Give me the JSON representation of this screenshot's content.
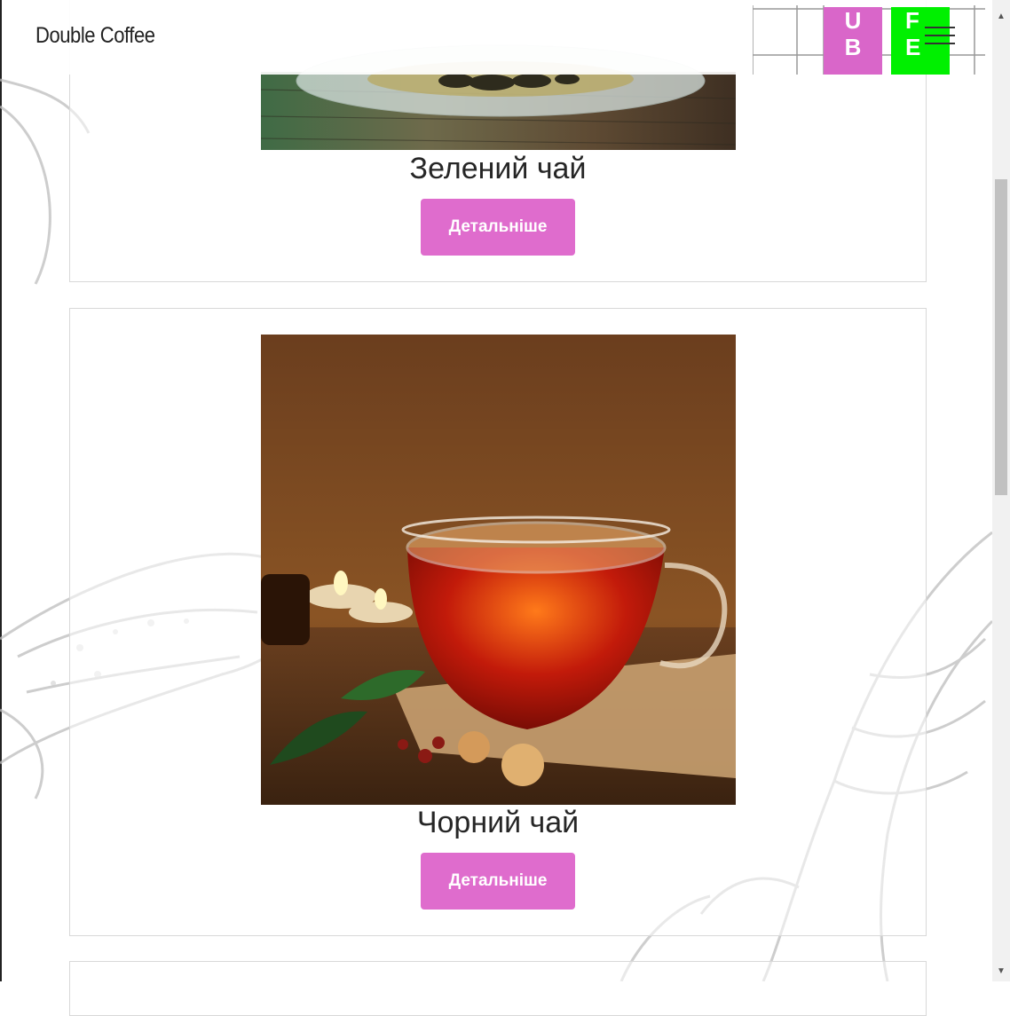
{
  "header": {
    "brand": "Double Coffee",
    "logo_ub": [
      "U",
      "B"
    ],
    "logo_fe": [
      "F",
      "E"
    ],
    "menu_icon": "hamburger-icon"
  },
  "products": [
    {
      "name": "Зелений чай",
      "button_label": "Детальніше",
      "image": "green-tea-photo"
    },
    {
      "name": "Чорний чай",
      "button_label": "Детальніше",
      "image": "black-tea-photo"
    }
  ],
  "colors": {
    "button": "#df6ccd",
    "logo_ub": "#d966c9",
    "logo_fe": "#00f000"
  },
  "scrollbar": {
    "up_icon": "scroll-up-arrow-icon",
    "down_icon": "scroll-down-arrow-icon"
  }
}
